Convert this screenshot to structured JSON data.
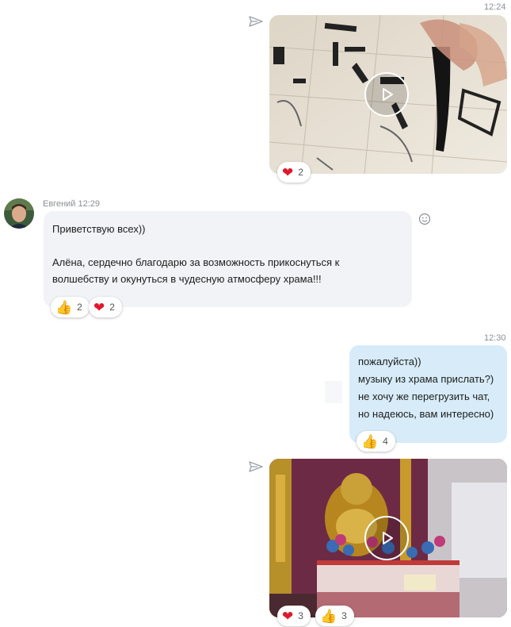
{
  "messages": [
    {
      "time": "12:24",
      "type": "video",
      "reactions": [
        {
          "emoji": "❤",
          "count": "2"
        }
      ]
    },
    {
      "sender": "Евгений",
      "time": "12:29",
      "text": "Приветствую всех))\n\nАлёна, сердечно благодарю за возможность прикоснуться к\nволшебству и окунуться в чудесную атмосферу храма!!!",
      "reactions": [
        {
          "emoji": "👍",
          "count": "2"
        },
        {
          "emoji": "❤",
          "count": "2"
        }
      ]
    },
    {
      "time": "12:30",
      "text": "пожалуйста))\nмузыку из храма прислать?)\nне хочу же перегрузить чат,\nно надеюсь, вам интересно)",
      "reactions": [
        {
          "emoji": "👍",
          "count": "4"
        }
      ]
    },
    {
      "type": "video",
      "reactions": [
        {
          "emoji": "❤",
          "count": "3"
        },
        {
          "emoji": "👍",
          "count": "3"
        }
      ]
    }
  ],
  "colors": {
    "incoming_bubble": "#f1f3f6",
    "outgoing_bubble": "#d7ecf8",
    "heart": "#e0182b"
  }
}
